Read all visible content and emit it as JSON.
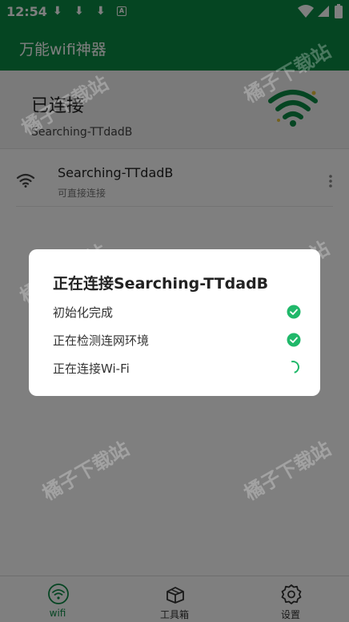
{
  "status_bar": {
    "time": "12:54",
    "download_glyph": "⬇",
    "badge_letter": "A"
  },
  "app_bar": {
    "title": "万能wifi神器"
  },
  "connected": {
    "label": "已连接",
    "ssid": "Searching-TTdadB"
  },
  "networks": [
    {
      "name": "Searching-TTdadB",
      "subtitle": "可直接连接"
    }
  ],
  "dialog": {
    "title": "正在连接Searching-TTdadB",
    "steps": [
      {
        "label": "初始化完成",
        "state": "done"
      },
      {
        "label": "正在检测连网环境",
        "state": "done"
      },
      {
        "label": "正在连接Wi-Fi",
        "state": "loading"
      }
    ]
  },
  "bottom_nav": {
    "items": [
      {
        "label": "wifi",
        "icon": "wifi-icon",
        "active": true
      },
      {
        "label": "工具箱",
        "icon": "toolbox-icon",
        "active": false
      },
      {
        "label": "设置",
        "icon": "gear-icon",
        "active": false
      }
    ]
  },
  "watermark": {
    "text": "橘子下载站"
  },
  "colors": {
    "brand": "#0a8a45",
    "check": "#20b86a"
  }
}
